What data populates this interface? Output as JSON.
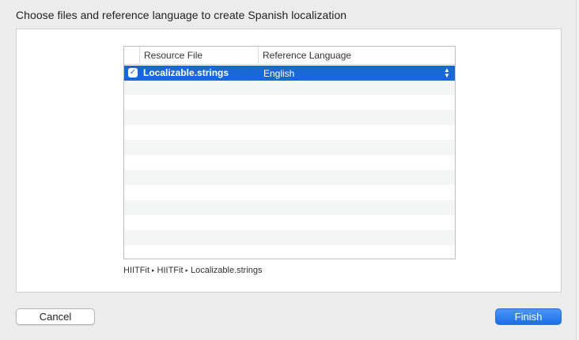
{
  "heading": "Choose files and reference language to create Spanish localization",
  "table": {
    "columns": {
      "check": "",
      "file": "Resource File",
      "language": "Reference Language"
    },
    "rows": [
      {
        "checked": true,
        "check_glyph": "✓",
        "file": "Localizable.strings",
        "language": "English",
        "selected": true
      }
    ]
  },
  "path": {
    "segments": [
      "HIITFit",
      "HIITFit",
      "Localizable.strings"
    ],
    "separator": "▸"
  },
  "buttons": {
    "cancel": "Cancel",
    "finish": "Finish"
  },
  "icons": {
    "checkbox": "checkmark-icon",
    "stepper": "up-down-stepper-icon",
    "separator": "triangle-right-icon"
  },
  "colors": {
    "selection": "#1a68d6",
    "primary_button": "#1b6fe6"
  }
}
